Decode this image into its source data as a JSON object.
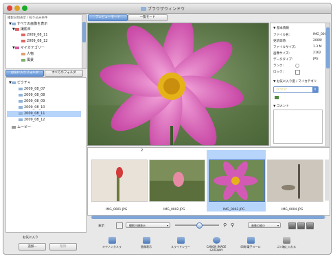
{
  "window": {
    "title": "ブラウザウィンドウ"
  },
  "colors": {
    "accent": "#4f7bbf",
    "selection": "#b7d4fb"
  },
  "left_top": {
    "header": "撮影日別表示 / 絞り込み条件",
    "items": [
      {
        "label": "すべての画像を表示",
        "icon": "picture-icon"
      },
      {
        "label": "撮影日",
        "icon": "calendar-icon"
      },
      {
        "label": "2009_08_11",
        "icon": "calendar-icon"
      },
      {
        "label": "2009_08_12",
        "icon": "calendar-icon"
      },
      {
        "label": "マイカテゴリー",
        "icon": "heart-icon"
      },
      {
        "label": "人物",
        "icon": "person-icon"
      },
      {
        "label": "風景",
        "icon": "landscape-icon"
      }
    ]
  },
  "tabs_left": {
    "fav": "お気に入りフォルダ",
    "all": "すべてのフォルダ"
  },
  "folders": {
    "root": "ピクチャ",
    "items": [
      "2009_08_07",
      "2009_08_08",
      "2009_08_09",
      "2009_08_10",
      "2009_08_11",
      "2009_08_12"
    ],
    "selected_index": 4,
    "movies": "ムービー"
  },
  "left_bottom": {
    "label": "お気に入り",
    "add": "追加...",
    "delete": "削除"
  },
  "mode_tabs": {
    "preview": "プレビューモード",
    "list": "一覧モード"
  },
  "info": {
    "basic_header": "基本情報",
    "rows": [
      {
        "label": "ファイル名:",
        "value": "IMG_0003"
      },
      {
        "label": "更新日時:",
        "value": "2009/"
      },
      {
        "label": "ファイルサイズ:",
        "value": "1.3 M"
      },
      {
        "label": "画像サイズ:",
        "value": "2162"
      },
      {
        "label": "データタイプ:",
        "value": "JPG"
      },
      {
        "label": "ランク:",
        "value": ""
      },
      {
        "label": "ロック:",
        "value": ""
      }
    ],
    "fav_header": "お気に入り度 / マイカテゴリ",
    "rating": "☆☆☆",
    "comment_header": "コメント"
  },
  "thumbs": {
    "counter": "2",
    "items": [
      {
        "label": "IMG_0001.JPG",
        "selected": false
      },
      {
        "label": "IMG_0002.JPG",
        "selected": false
      },
      {
        "label": "IMG_0003.JPG",
        "selected": true
      },
      {
        "label": "IMG_0004.JPG",
        "selected": false
      }
    ]
  },
  "controls": {
    "display_label": "表示",
    "sort_select": "撮影日順表示",
    "scale_select": "画像の縮小",
    "zoom_level_fraction": 0.55
  },
  "tools": [
    {
      "label": "キヤノンカメラ",
      "icon": "camera-icon"
    },
    {
      "label": "画像表示",
      "icon": "image-view-icon"
    },
    {
      "label": "スライドショー",
      "icon": "slideshow-icon"
    },
    {
      "label": "CANON iMAGE GATEWAY",
      "icon": "gateway-icon"
    },
    {
      "label": "印刷/電子メール",
      "icon": "print-icon"
    },
    {
      "label": "ゴミ箱に入れる",
      "icon": "trash-icon"
    }
  ]
}
